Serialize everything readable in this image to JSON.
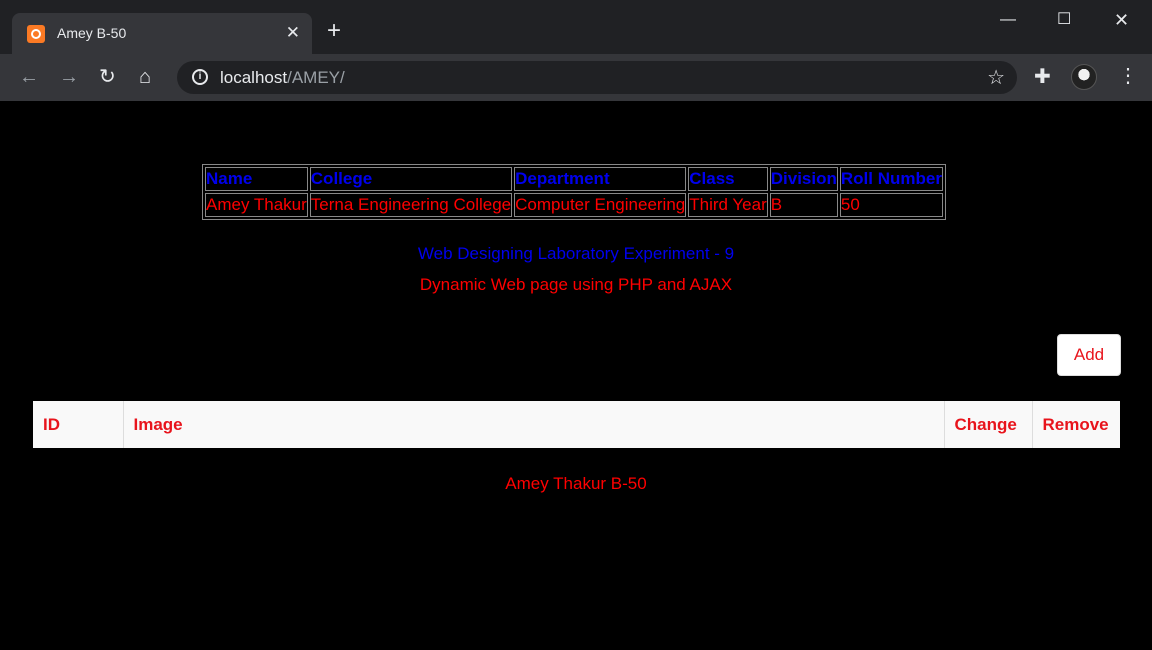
{
  "browser": {
    "tab_title": "Amey B-50",
    "tab_close": "✕",
    "new_tab": "+",
    "url_host": "localhost",
    "url_path": "/AMEY/",
    "window_controls": {
      "minimize": "—",
      "maximize": "☐",
      "close": "✕"
    },
    "icons": {
      "back": "arrow-left-icon",
      "forward": "arrow-right-icon",
      "reload": "reload-icon",
      "home": "home-icon",
      "info": "info-icon",
      "star": "star-icon",
      "extensions": "puzzle-icon",
      "menu": "kebab-menu-icon"
    }
  },
  "info_table": {
    "headers": [
      "Name",
      "College",
      "Department",
      "Class",
      "Division",
      "Roll Number"
    ],
    "row": [
      "Amey Thakur",
      "Terna Engineering College",
      "Computer Engineering",
      "Third Year",
      "B",
      "50"
    ]
  },
  "subtitle_lab": "Web Designing Laboratory Experiment - 9",
  "subtitle_topic": "Dynamic Web page using PHP and AJAX",
  "add_button": "Add",
  "data_table": {
    "headers": [
      "ID",
      "Image",
      "Change",
      "Remove"
    ]
  },
  "footer": "Amey Thakur B-50",
  "colors": {
    "header_blue": "#0000ee",
    "text_red": "#ff0000",
    "page_background": "#000000"
  }
}
